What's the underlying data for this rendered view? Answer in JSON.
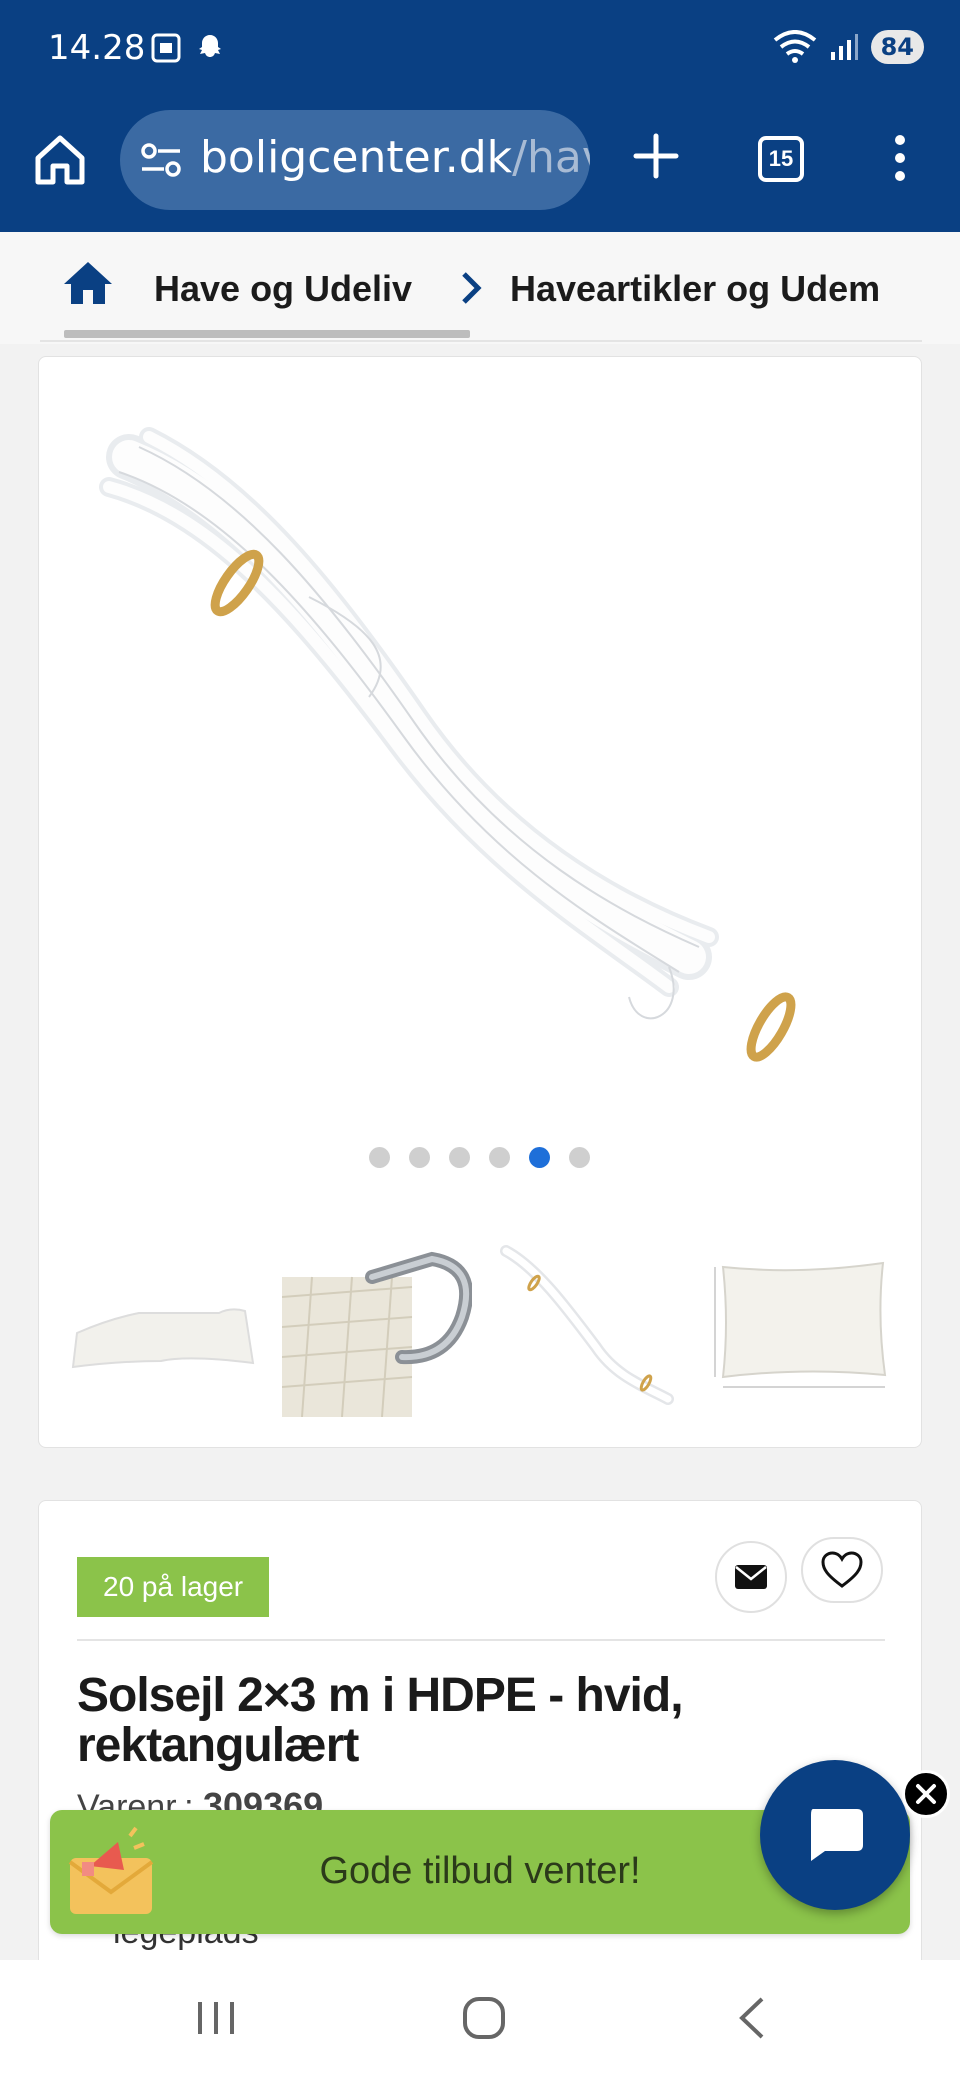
{
  "status_bar": {
    "time": "14.28",
    "battery": "84"
  },
  "browser": {
    "url_host": "boligcenter.dk",
    "url_path": "/hav",
    "tab_count": "15"
  },
  "breadcrumb": {
    "item1": "Have og Udeliv",
    "item2": "Haveartikler og Udem"
  },
  "gallery": {
    "dot_count": 6,
    "active_dot": 5
  },
  "product": {
    "stock": "20 på lager",
    "title": "Solsejl 2×3 m i HDPE - hvid, rektangulært",
    "varenr_label": "Varenr.:",
    "varenr_value": "309369",
    "category_text": "legeplads"
  },
  "promo": {
    "text": "Gode tilbud venter!"
  },
  "colors": {
    "brand_blue": "#0a4083",
    "accent_green": "#8bc34a",
    "active_dot": "#1e6fd9"
  }
}
